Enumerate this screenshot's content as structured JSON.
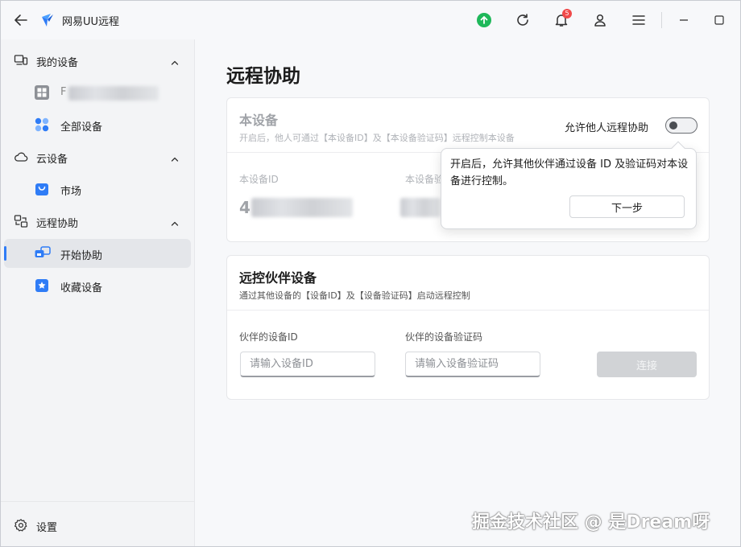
{
  "app": {
    "title": "网易UU远程"
  },
  "titlebar": {
    "icons": [
      "back-arrow-icon",
      "uu-logo-icon",
      "upload-icon",
      "refresh-icon",
      "bell-icon",
      "user-icon",
      "menu-icon",
      "minimize-icon",
      "maximize-icon"
    ],
    "notification_count": "5"
  },
  "sidebar": {
    "sections": [
      {
        "label": "我的设备"
      },
      {
        "label": "云设备"
      },
      {
        "label": "远程协助"
      }
    ],
    "items": [
      {
        "label": "F"
      },
      {
        "label": "全部设备"
      },
      {
        "label": "市场"
      },
      {
        "label": "开始协助"
      },
      {
        "label": "收藏设备"
      }
    ],
    "settings_label": "设置"
  },
  "main": {
    "page_title": "远程协助",
    "this_device": {
      "title": "本设备",
      "subtitle": "开启后，他人可通过【本设备ID】及【本设备验证码】远程控制本设备",
      "toggle_label": "允许他人远程协助",
      "toggle_on": false,
      "id_label": "本设备ID",
      "code_label": "本设备验",
      "id_value": "4"
    },
    "partner": {
      "title": "远控伙伴设备",
      "subtitle": "通过其他设备的【设备ID】及【设备验证码】启动远程控制",
      "id_label": "伙伴的设备ID",
      "id_placeholder": "请输入设备ID",
      "code_label": "伙伴的设备验证码",
      "code_placeholder": "请输入设备验证码",
      "connect_label": "连接"
    },
    "popover": {
      "text": "开启后，允许其他伙伴通过设备 ID 及验证码对本设备进行控制。",
      "next_label": "下一步"
    }
  },
  "watermark": "掘金技术社区 @ 是Dream呀",
  "colors": {
    "accent": "#2f7cf6",
    "upload_green": "#1fb85a",
    "badge_red": "#f04a4a"
  }
}
